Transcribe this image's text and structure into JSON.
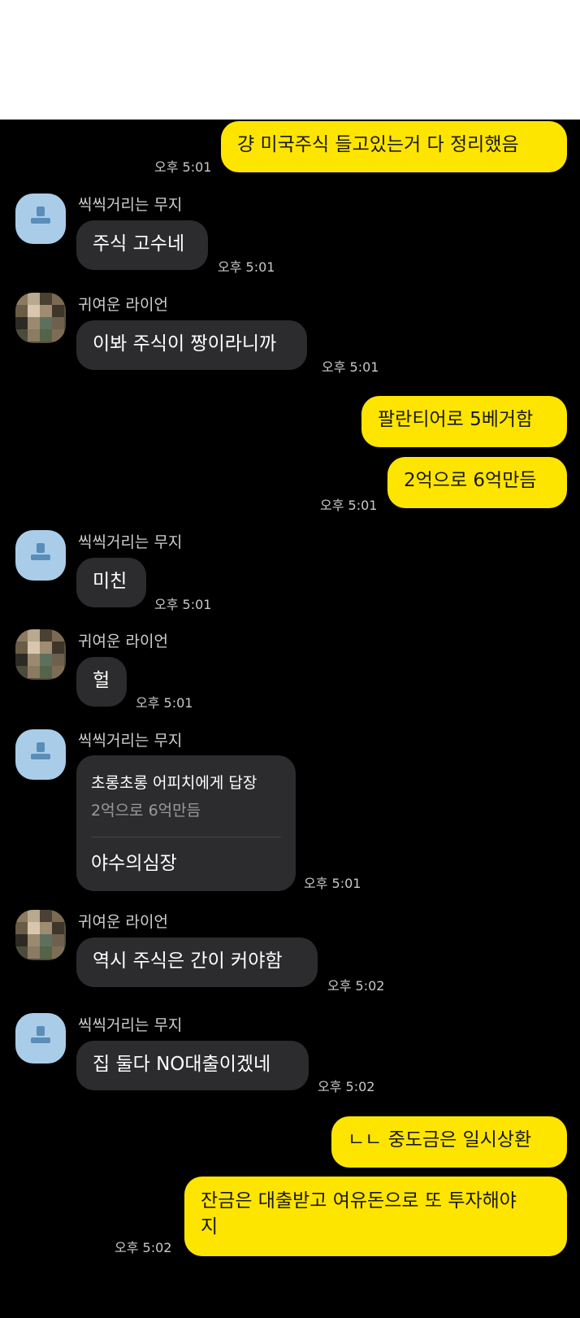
{
  "users": {
    "muji": "씩씩거리는 무지",
    "ryan": "귀여운 라이언"
  },
  "messages": {
    "m1": {
      "text": "걍 미국주식 들고있는거 다 정리했음",
      "time": "오후 5:01"
    },
    "m2": {
      "text": "주식 고수네",
      "time": "오후 5:01"
    },
    "m3": {
      "text": "이봐 주식이 짱이라니까",
      "time": "오후 5:01"
    },
    "m4": {
      "text": "팔란티어로 5베거함"
    },
    "m5": {
      "text": "2억으로 6억만듬",
      "time": "오후 5:01"
    },
    "m6": {
      "text": "미친",
      "time": "오후 5:01"
    },
    "m7": {
      "text": "헐",
      "time": "오후 5:01"
    },
    "m8": {
      "reply_title": "초롱초롱 어피치에게 답장",
      "reply_quote": "2억으로 6억만듬",
      "text": "야수의심장",
      "time": "오후 5:01"
    },
    "m9": {
      "text": "역시 주식은 간이 커야함",
      "time": "오후 5:02"
    },
    "m10": {
      "text": "집 둘다 NO대출이겠네",
      "time": "오후 5:02"
    },
    "m11": {
      "text": "ㄴㄴ 중도금은 일시상환"
    },
    "m12": {
      "line1": "잔금은 대출받고 여유돈으로 또 투자해야",
      "line2": "지",
      "time": "오후 5:02"
    }
  },
  "colors": {
    "my_bubble": "#FEE500",
    "their_bubble": "#2c2c2e",
    "background": "#000000"
  }
}
